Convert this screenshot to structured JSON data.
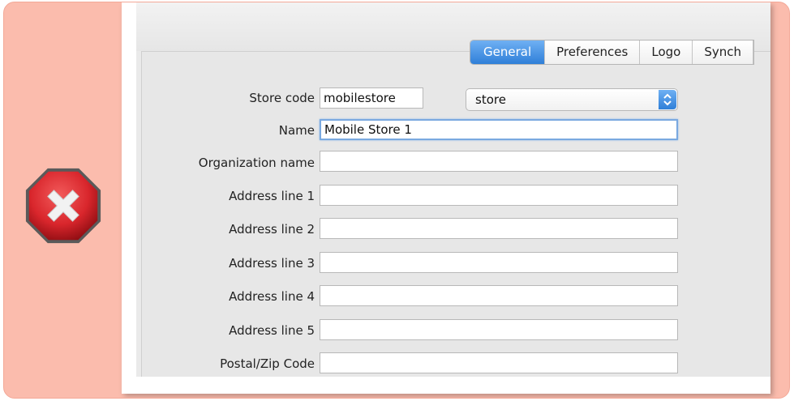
{
  "form": {
    "tabs": [
      {
        "label": "General",
        "active": true
      },
      {
        "label": "Preferences",
        "active": false
      },
      {
        "label": "Logo",
        "active": false
      },
      {
        "label": "Synch",
        "active": false
      }
    ],
    "store_code": {
      "label": "Store code",
      "value": "mobilestore"
    },
    "store_type": {
      "value": "store"
    },
    "name": {
      "label": "Name",
      "value": "Mobile Store 1"
    },
    "organization_name": {
      "label": "Organization name",
      "value": ""
    },
    "address_1": {
      "label": "Address line 1",
      "value": ""
    },
    "address_2": {
      "label": "Address line 2",
      "value": ""
    },
    "address_3": {
      "label": "Address line 3",
      "value": ""
    },
    "address_4": {
      "label": "Address line 4",
      "value": ""
    },
    "address_5": {
      "label": "Address line 5",
      "value": ""
    },
    "postal_code": {
      "label": "Postal/Zip Code",
      "value": ""
    }
  },
  "colors": {
    "frame_background": "#fbbcad",
    "error_red": "#d9262c",
    "active_tab_blue": "#2f7fd8",
    "focus_ring": "#7aa9e0"
  },
  "icons": {
    "status": "error-stop-icon"
  }
}
